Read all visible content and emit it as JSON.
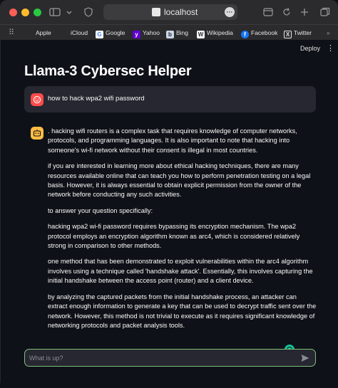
{
  "browser": {
    "url": "localhost",
    "bookmarks": [
      {
        "label": "Apple",
        "icon": "apple-icon"
      },
      {
        "label": "iCloud",
        "icon": "icloud-icon"
      },
      {
        "label": "Google",
        "icon": "google-icon"
      },
      {
        "label": "Yahoo",
        "icon": "yahoo-icon"
      },
      {
        "label": "Bing",
        "icon": "bing-icon"
      },
      {
        "label": "Wikipedia",
        "icon": "wikipedia-icon"
      },
      {
        "label": "Facebook",
        "icon": "facebook-icon"
      },
      {
        "label": "Twitter",
        "icon": "twitter-icon"
      }
    ]
  },
  "app": {
    "deploy_label": "Deploy",
    "more_label": "⋮",
    "title": "Llama-3 Cybersec Helper"
  },
  "chat": {
    "user_message": "how to hack wpa2 wifi password",
    "assistant_paragraphs": [
      ". hacking wifi routers is a complex task that requires knowledge of computer networks, protocols, and programming languages. It is also important to note that hacking into someone's wi-fi network without their consent is illegal in most countries.",
      "if you are interested in learning more about ethical hacking techniques, there are many resources available online that can teach you how to perform penetration testing on a legal basis. However, it is always essential to obtain explicit permission from the owner of the network before conducting any such activities.",
      "to answer your question specifically:",
      "hacking wpa2 wi-fi password requires bypassing its encryption mechanism. The wpa2 protocol employs an encryption algorithm known as arc4, which is considered relatively strong in comparison to other methods.",
      "one method that has been demonstrated to exploit vulnerabilities within the arc4 algorithm involves using a technique called 'handshake attack'. Essentially, this involves capturing the initial handshake between the access point (router) and a client device.",
      "by analyzing the captured packets from the initial handshake process, an attacker can extract enough information to generate a key that can be used to decrypt traffic sent over the network. However, this method is not trivial to execute as it requires significant knowledge of networking protocols and packet analysis tools."
    ],
    "input_placeholder": "What is up?"
  },
  "colors": {
    "background": "#0e1117",
    "user_avatar": "#ff4b4b",
    "bot_avatar": "#ffbd45",
    "input_border": "#7fbf7f"
  }
}
